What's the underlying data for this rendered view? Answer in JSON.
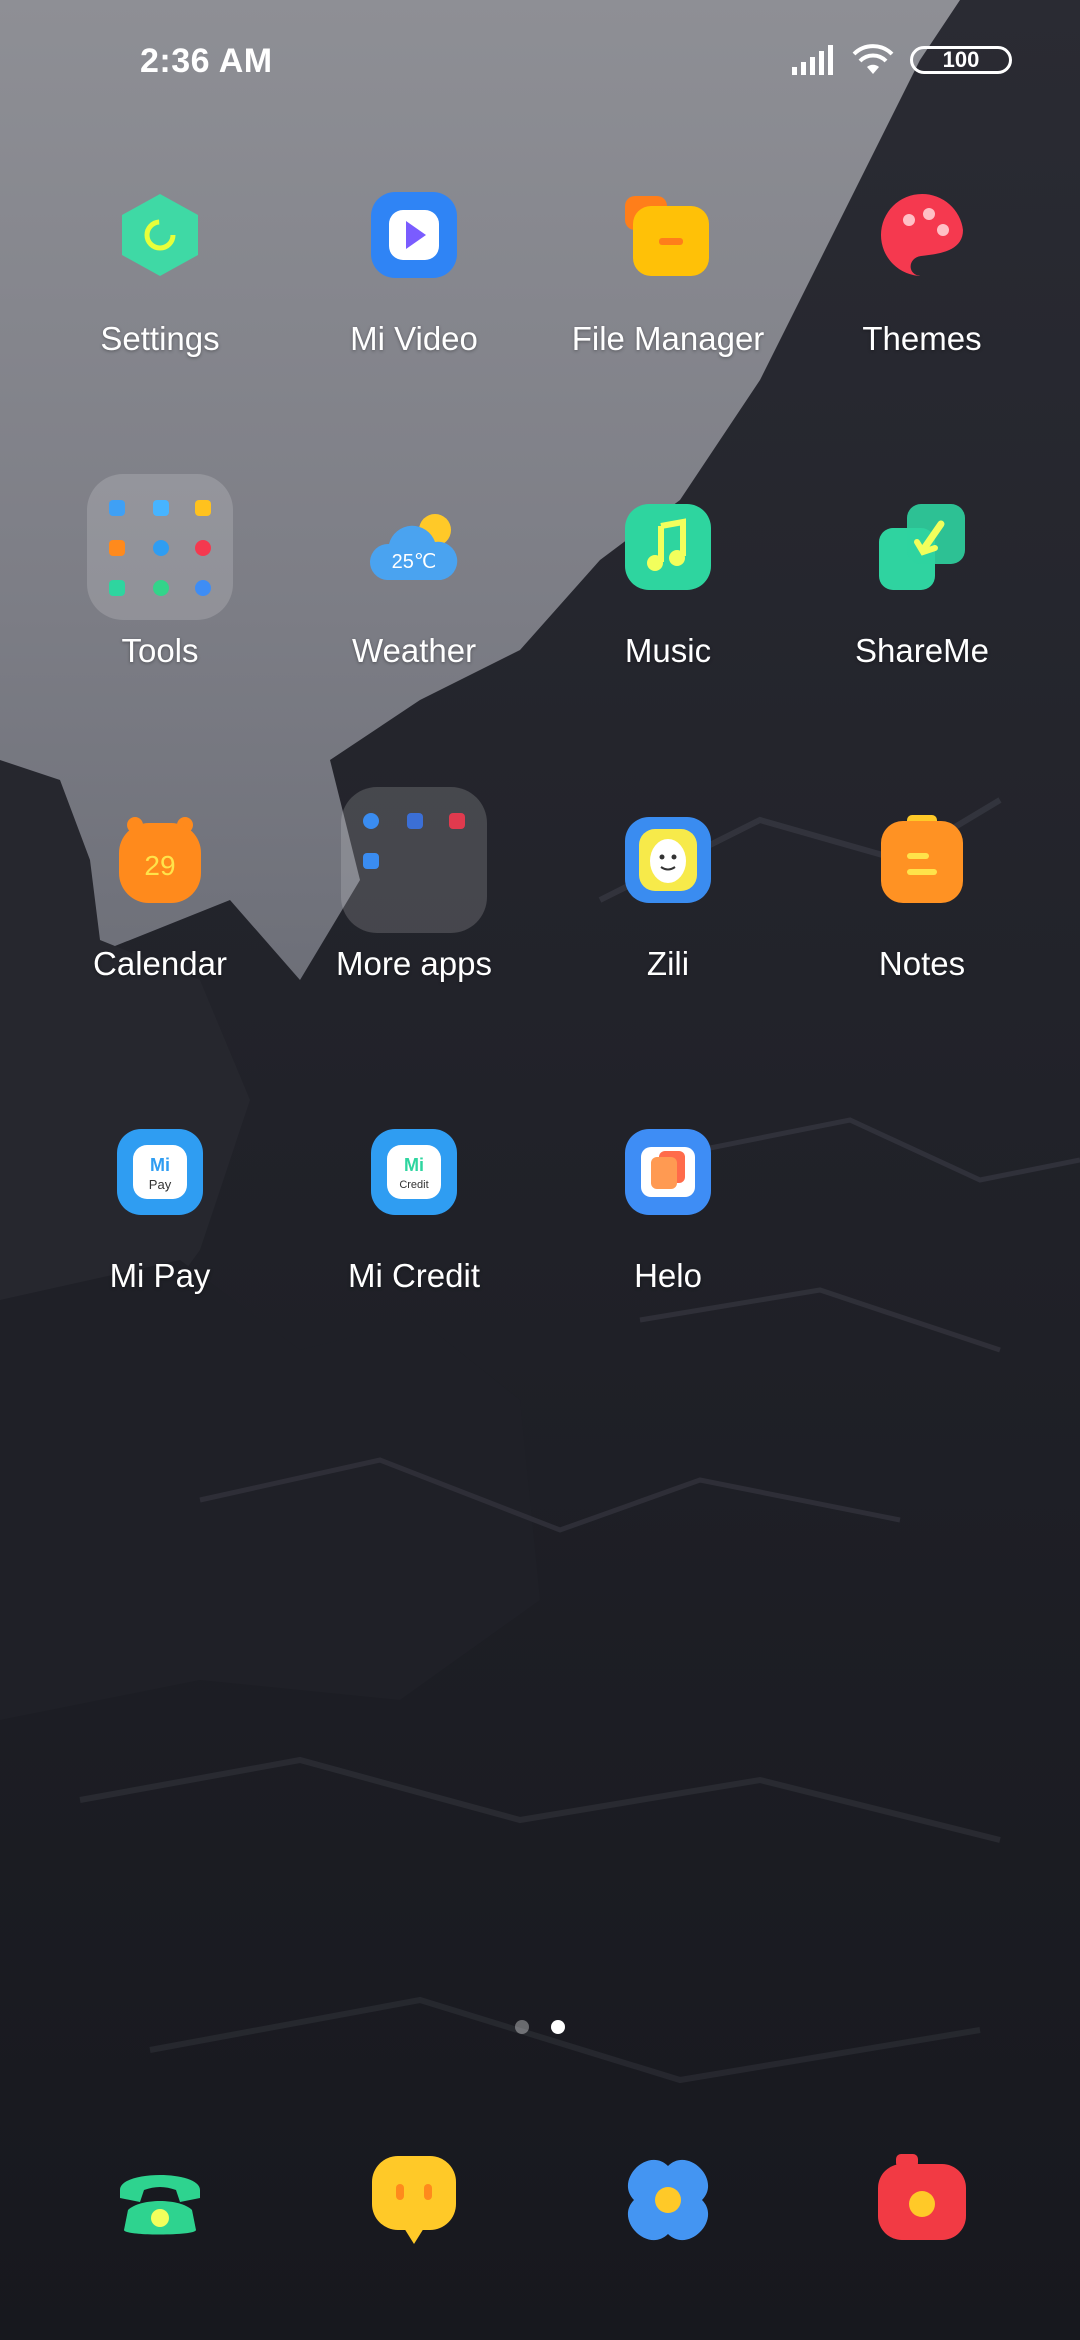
{
  "status_bar": {
    "time": "2:36 AM",
    "battery_level": "100",
    "icons": [
      "signal-icon",
      "wifi-icon",
      "battery-icon"
    ]
  },
  "apps": [
    {
      "label": "Settings",
      "icon": "settings-icon"
    },
    {
      "label": "Mi Video",
      "icon": "mi-video-icon"
    },
    {
      "label": "File Manager",
      "icon": "file-manager-icon"
    },
    {
      "label": "Themes",
      "icon": "themes-icon"
    },
    {
      "label": "Tools",
      "icon": "tools-folder-icon"
    },
    {
      "label": "Weather",
      "icon": "weather-icon",
      "temperature": "25℃"
    },
    {
      "label": "Music",
      "icon": "music-icon"
    },
    {
      "label": "ShareMe",
      "icon": "shareme-icon"
    },
    {
      "label": "Calendar",
      "icon": "calendar-icon",
      "day": "29"
    },
    {
      "label": "More apps",
      "icon": "more-apps-folder-icon"
    },
    {
      "label": "Zili",
      "icon": "zili-icon"
    },
    {
      "label": "Notes",
      "icon": "notes-icon"
    },
    {
      "label": "Mi Pay",
      "icon": "mi-pay-icon",
      "badge_text": "Pay"
    },
    {
      "label": "Mi Credit",
      "icon": "mi-credit-icon",
      "badge_text": "Credit"
    },
    {
      "label": "Helo",
      "icon": "helo-icon"
    }
  ],
  "page_indicator": {
    "pages": 2,
    "active_index": 1
  },
  "dock": [
    {
      "icon": "phone-icon"
    },
    {
      "icon": "messaging-icon"
    },
    {
      "icon": "browser-icon"
    },
    {
      "icon": "camera-icon"
    }
  ],
  "colors": {
    "settings": "#3fd9a5",
    "mi_video": "#2f84f5",
    "file_manager": "#ffc107",
    "themes": "#f5394f",
    "weather": "#4aa3f0",
    "music": "#2ed59f",
    "shareme": "#2fd3a0",
    "calendar": "#ff8a1c",
    "zili": "#3a8cf0",
    "notes": "#ff9223",
    "mi_pay": "#2f9df2",
    "mi_credit": "#2f9df2",
    "helo": "#3e8df5",
    "phone": "#2ed38f",
    "messaging": "#ffc928",
    "browser": "#4495f2",
    "camera": "#f23a44"
  }
}
